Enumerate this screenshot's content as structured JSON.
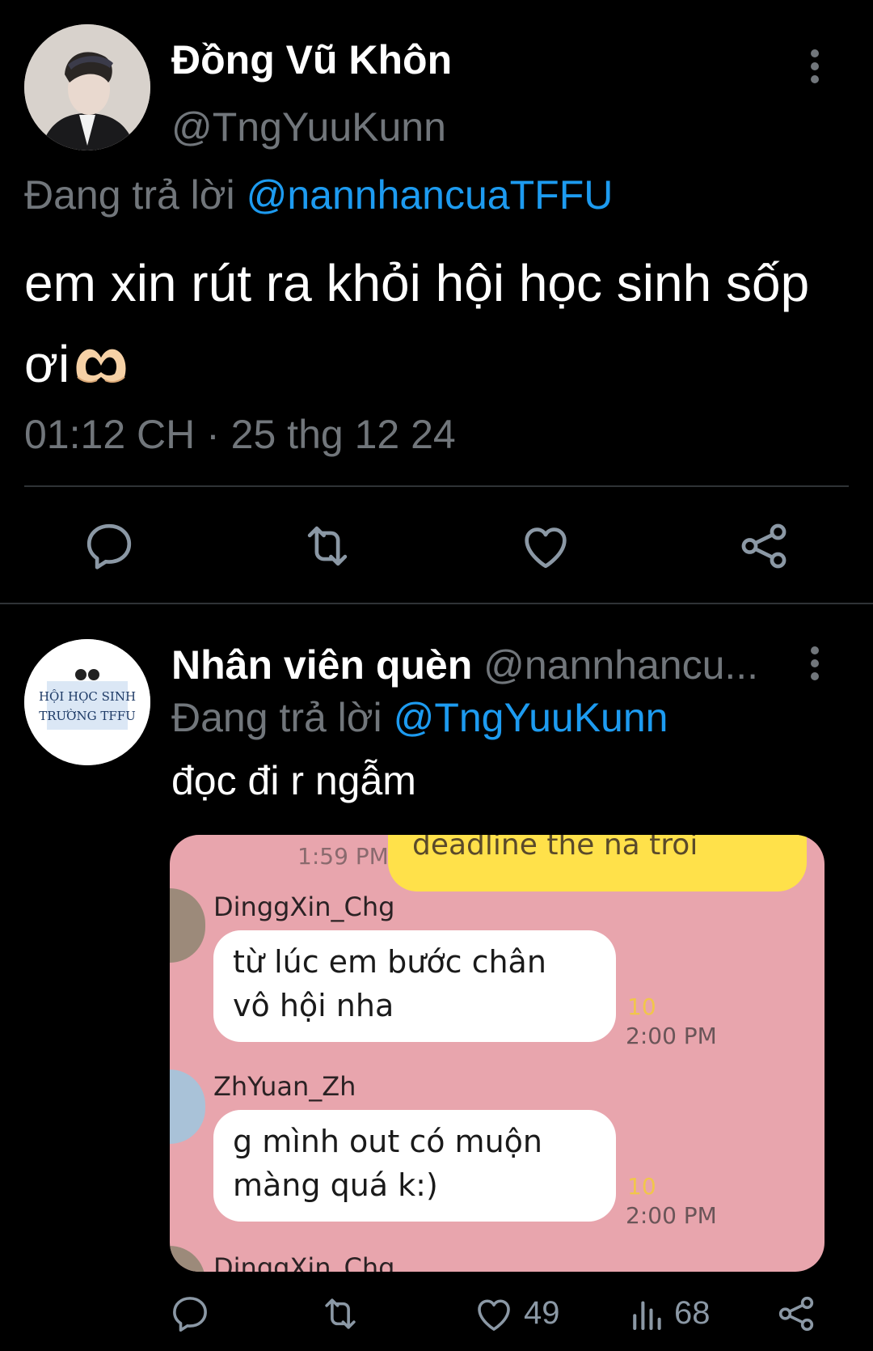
{
  "tweet1": {
    "display_name": "Đồng Vũ Khôn",
    "handle": "@TngYuuKunn",
    "replying_prefix": "Đang trả lời",
    "replying_to": "@nannhancuaTFFU",
    "text": "em xin rút ra khỏi hội học sinh sốp ơi",
    "emoji": "heart-hands",
    "timestamp": "01:12 CH · 25 thg 12 24",
    "actions": [
      "reply-icon",
      "retweet-icon",
      "like-icon",
      "share-icon"
    ]
  },
  "tweet2": {
    "display_name": "Nhân viên quèn",
    "handle": "@nannhancu...",
    "replying_prefix": "Đang trả lời",
    "replying_to": "@TngYuuKunn",
    "text": "đọc đi r ngẫm",
    "avatar_text": [
      "HỘI HỌC SINH",
      "TRƯỜNG TFFU"
    ],
    "chat_image": {
      "top_bubble_text": "deadline the na troi",
      "top_time": "1:59 PM",
      "messages": [
        {
          "user": "DinggXin_Chg",
          "text_line1": "từ lúc em bước chân",
          "text_line2": "vô hội nha",
          "count": "10",
          "time": "2:00 PM"
        },
        {
          "user": "ZhYuan_Zh",
          "text_line1": "g mình out có muộn",
          "text_line2": "màng quá k:)",
          "count": "10",
          "time": "2:00 PM"
        },
        {
          "user": "DinggXin_Chg"
        }
      ]
    },
    "stats": {
      "likes": "49",
      "views": "68"
    }
  },
  "colors": {
    "background": "#000000",
    "text": "#e7e9ea",
    "muted": "#71767b",
    "accent": "#1d9bf0",
    "chat_bg": "#e8a5ad"
  }
}
